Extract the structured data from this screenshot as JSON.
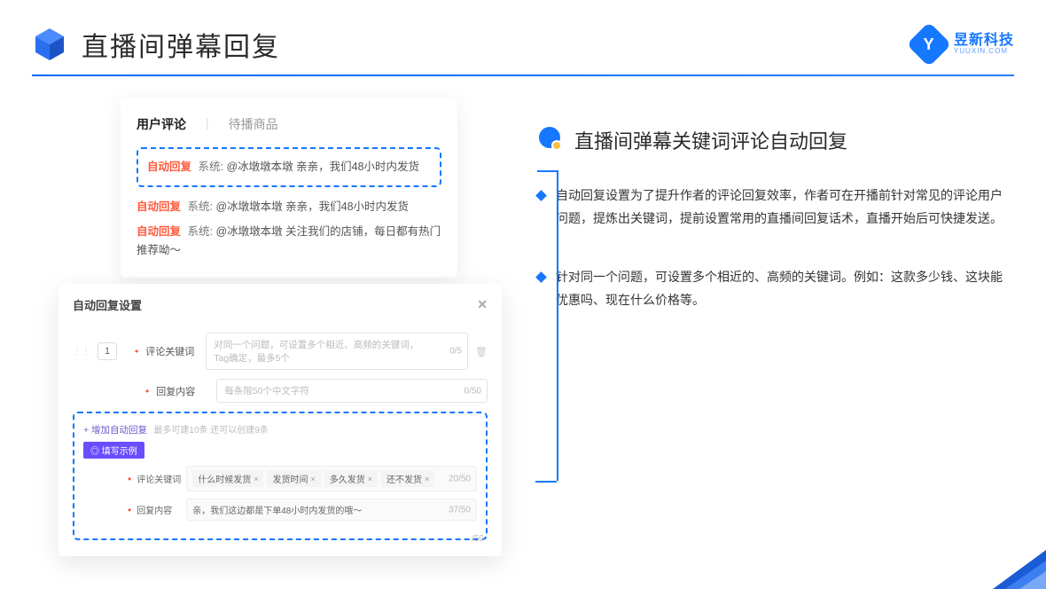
{
  "header": {
    "title": "直播间弹幕回复",
    "brand_name": "昱新科技",
    "brand_sub": "YUUXIN.COM",
    "brand_letter": "Y"
  },
  "comments": {
    "tab_active": "用户评论",
    "tab_inactive": "待播商品",
    "auto_tag": "自动回复",
    "sys_tag": "系统:",
    "line1": "@冰墩墩本墩 亲亲，我们48小时内发货",
    "line2": "@冰墩墩本墩 亲亲，我们48小时内发货",
    "line3": "@冰墩墩本墩 关注我们的店铺，每日都有热门推荐呦～"
  },
  "settings": {
    "title": "自动回复设置",
    "idx": "1",
    "label_keyword": "评论关键词",
    "keyword_placeholder": "对同一个问题，可设置多个相近、高频的关键词，Tag确定，最多5个",
    "keyword_counter": "0/5",
    "label_reply": "回复内容",
    "reply_placeholder": "每条限50个中文字符",
    "reply_counter": "0/50",
    "add_link": "+ 增加自动回复",
    "add_hint": "最多可建10条 还可以创建9条",
    "example_chip": "◎ 填写示例",
    "ex_label_keyword": "评论关键词",
    "ex_tags": [
      "什么时候发货",
      "发货时间",
      "多久发货",
      "还不发货"
    ],
    "ex_keyword_counter": "20/50",
    "ex_label_reply": "回复内容",
    "ex_reply_value": "亲，我们这边都是下单48小时内发货的哦～",
    "ex_reply_counter": "37/50",
    "stray_counter": "/50"
  },
  "right": {
    "section_heading": "直播间弹幕关键词评论自动回复",
    "bullets": [
      "自动回复设置为了提升作者的评论回复效率，作者可在开播前针对常见的评论用户问题，提炼出关键词，提前设置常用的直播间回复话术，直播开始后可快捷发送。",
      "针对同一个问题，可设置多个相近的、高频的关键词。例如：这款多少钱、这块能优惠吗、现在什么价格等。"
    ]
  }
}
